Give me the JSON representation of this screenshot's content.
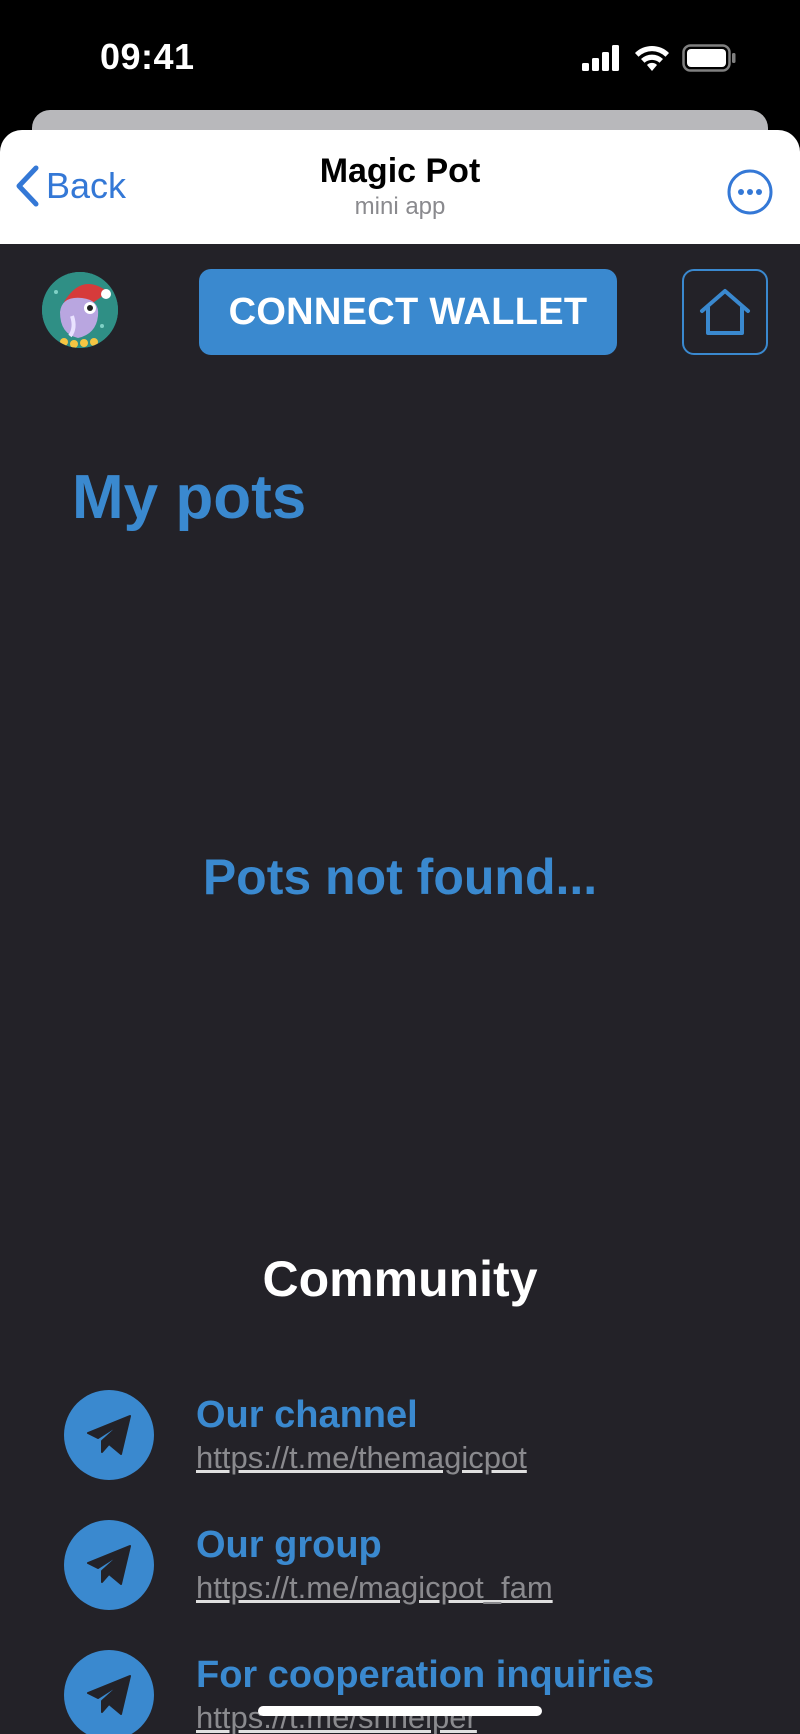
{
  "status_bar": {
    "time": "09:41",
    "icons": [
      "signal-icon",
      "wifi-icon",
      "battery-icon"
    ]
  },
  "header": {
    "back_label": "Back",
    "title": "Magic Pot",
    "subtitle": "mini app",
    "more_icon": "more-icon"
  },
  "toolbar": {
    "avatar_icon": "magic-pot-avatar-icon",
    "connect_label": "CONNECT WALLET",
    "home_icon": "home-icon"
  },
  "main": {
    "heading": "My pots",
    "empty_message": "Pots not found..."
  },
  "community": {
    "heading": "Community",
    "items": [
      {
        "title": "Our channel",
        "link": "https://t.me/themagicpot",
        "icon": "telegram-icon"
      },
      {
        "title": "Our group",
        "link": "https://t.me/magicpot_fam",
        "icon": "telegram-icon"
      },
      {
        "title": "For cooperation inquiries",
        "link": "https://t.me/shhelper",
        "icon": "telegram-icon"
      }
    ]
  },
  "colors": {
    "accent": "#3a89cf",
    "ios_blue": "#3478d6",
    "background": "#232228",
    "header_bg": "#ffffff",
    "text_white": "#ffffff",
    "muted": "#8a8a8e"
  }
}
